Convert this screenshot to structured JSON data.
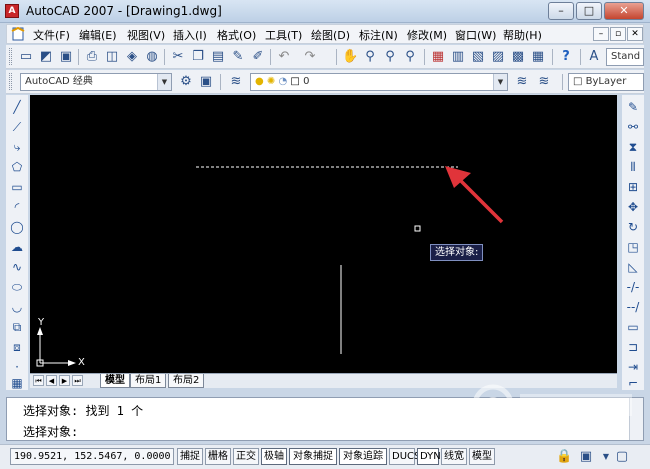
{
  "window": {
    "title": "AutoCAD 2007 - [Drawing1.dwg]",
    "controls": [
      "–",
      "□",
      "✕"
    ]
  },
  "menubar": {
    "items": [
      "文件(F)",
      "编辑(E)",
      "视图(V)",
      "插入(I)",
      "格式(O)",
      "工具(T)",
      "绘图(D)",
      "标注(N)",
      "修改(M)",
      "窗口(W)",
      "帮助(H)"
    ],
    "mdi_controls": [
      "–",
      "▫",
      "✕"
    ]
  },
  "toolbar": {
    "text_style_label": "Stand"
  },
  "workspace": {
    "value": "AutoCAD 经典"
  },
  "layers": {
    "current": "0",
    "bylayer": "ByLayer"
  },
  "canvas": {
    "tooltip": "选择对象:",
    "ucs_y": "Y",
    "ucs_x": "X"
  },
  "tabs": {
    "items": [
      "模型",
      "布局1",
      "布局2"
    ]
  },
  "command": {
    "line1": "选择对象: 找到 1 个",
    "line2": "选择对象:"
  },
  "status": {
    "coords": "190.9521,  152.5467, 0.0000",
    "buttons": [
      "捕捉",
      "栅格",
      "正交",
      "极轴",
      "对象捕捉",
      "对象追踪",
      "DUCS",
      "DYN",
      "线宽",
      "模型"
    ]
  },
  "colors": {
    "canvas_bg": "#000000",
    "arrow": "#e0343a",
    "tooltip_border": "#7f8fbf",
    "selected_line": "#ffffff"
  }
}
